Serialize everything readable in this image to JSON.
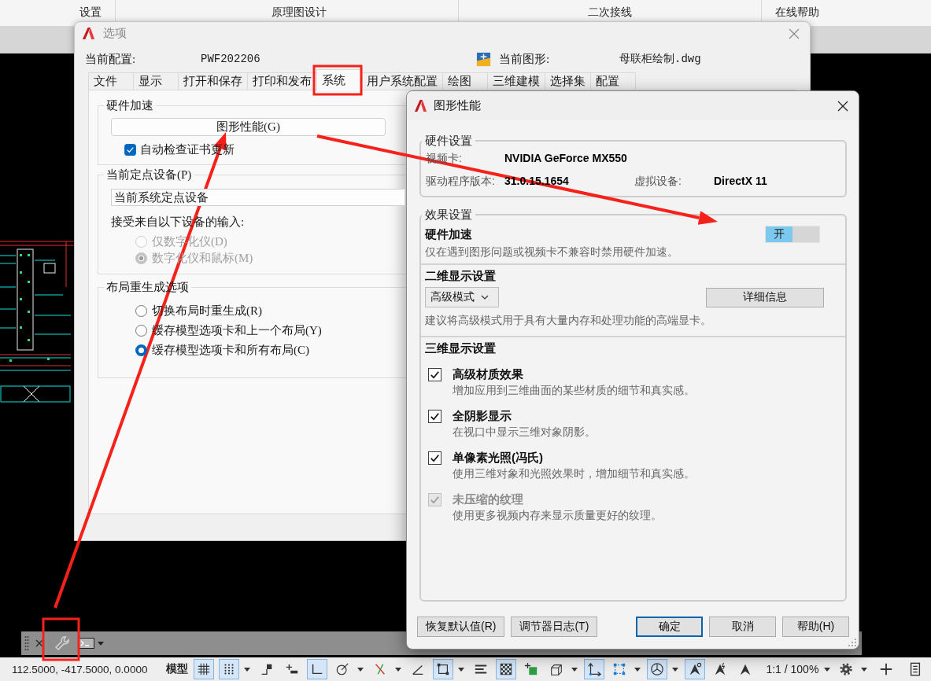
{
  "ribbon": {
    "panel_titles": [
      "设置",
      "原理图设计",
      "二次接线",
      "在线帮助"
    ]
  },
  "options_dialog": {
    "title": "选项",
    "profile_label": "当前配置:",
    "profile": "PWF202206",
    "drawing_label": "当前图形:",
    "drawing": "母联柜绘制.dwg",
    "tabs": [
      {
        "label": "文件",
        "selected": false
      },
      {
        "label": "显示",
        "selected": false
      },
      {
        "label": "打开和保存",
        "selected": false
      },
      {
        "label": "打印和发布",
        "selected": false
      },
      {
        "label": "系统",
        "selected": true
      },
      {
        "label": "用户系统配置",
        "selected": false
      },
      {
        "label": "绘图",
        "selected": false
      },
      {
        "label": "三维建模",
        "selected": false
      },
      {
        "label": "选择集",
        "selected": false
      },
      {
        "label": "配置",
        "selected": false
      }
    ],
    "hardware_group": {
      "title": "硬件加速",
      "button": "图形性能(G)",
      "checkbox": {
        "label": "自动检查证书更新",
        "checked": true
      }
    },
    "pointing_group": {
      "title": "当前定点设备(P)",
      "device": "当前系统定点设备",
      "input_label": "接受来自以下设备的输入:",
      "options": [
        {
          "label": "仅数字化仪(D)",
          "selected": false,
          "disabled": true
        },
        {
          "label": "数字化仪和鼠标(M)",
          "selected": true,
          "disabled": true
        }
      ]
    },
    "layout_group": {
      "title": "布局重生成选项",
      "options": [
        {
          "label": "切换布局时重生成(R)",
          "selected": false,
          "disabled": false
        },
        {
          "label": "缓存模型选项卡和上一个布局(Y)",
          "selected": false,
          "disabled": false
        },
        {
          "label": "缓存模型选项卡和所有布局(C)",
          "selected": true,
          "disabled": false
        }
      ]
    }
  },
  "graphics_dialog": {
    "title": "图形性能",
    "hardware": {
      "title": "硬件设置",
      "card_label": "视频卡:",
      "card": "NVIDIA GeForce MX550",
      "driver_label": "驱动程序版本:",
      "driver": "31.0.15.1654",
      "device_label": "虚拟设备:",
      "device": "DirectX 11"
    },
    "effects": {
      "title": "效果设置",
      "acceleration": {
        "title": "硬件加速",
        "toggle_label": "开",
        "on": true,
        "description": "仅在遇到图形问题或视频卡不兼容时禁用硬件加速。"
      },
      "display_2d": {
        "title": "二维显示设置",
        "mode": "高级模式",
        "details_button": "详细信息",
        "description": "建议将高级模式用于具有大量内存和处理功能的高端显卡。"
      },
      "display_3d": {
        "title": "三维显示设置",
        "options": [
          {
            "label": "高级材质效果",
            "description": "增加应用到三维曲面的某些材质的细节和真实感。",
            "checked": true,
            "disabled": false
          },
          {
            "label": "全阴影显示",
            "description": "在视口中显示三维对象阴影。",
            "checked": true,
            "disabled": false
          },
          {
            "label": "单像素光照(冯氏)",
            "description": "使用三维对象和光照效果时，增加细节和真实感。",
            "checked": true,
            "disabled": false
          },
          {
            "label": "未压缩的纹理",
            "description": "使用更多视频内存来显示质量更好的纹理。",
            "checked": true,
            "disabled": true
          }
        ]
      }
    },
    "buttons": [
      {
        "label": "恢复默认值(R)",
        "default": false
      },
      {
        "label": "调节器日志(T)",
        "default": false
      },
      {
        "label": "确定",
        "default": true
      },
      {
        "label": "取消",
        "default": false
      },
      {
        "label": "帮助(H)",
        "default": false
      }
    ]
  },
  "status_bar": {
    "coordinates": "112.5000, -417.5000, 0.0000",
    "space": "模型",
    "tools": [
      {
        "kind": "grid",
        "on": true,
        "menu": false
      },
      {
        "kind": "dot-grid",
        "on": true,
        "menu": true
      },
      {
        "kind": "steps",
        "on": false,
        "menu": false
      },
      {
        "kind": "plus-line",
        "on": false,
        "menu": false
      },
      {
        "kind": "corner",
        "on": true,
        "menu": false
      },
      {
        "kind": "circle-angle",
        "on": false,
        "menu": true
      },
      {
        "kind": "crossed-lines",
        "on": false,
        "menu": true
      },
      {
        "kind": "angle",
        "on": false,
        "menu": false
      },
      {
        "kind": "square-handles",
        "on": true,
        "menu": true
      },
      {
        "kind": "lines",
        "on": false,
        "menu": false
      },
      {
        "kind": "checker",
        "on": true,
        "menu": false
      },
      {
        "kind": "square-plus",
        "on": false,
        "menu": false
      },
      {
        "kind": "cube",
        "on": false,
        "menu": true
      },
      {
        "kind": "axes",
        "on": true,
        "menu": false
      },
      {
        "kind": "dashed-square",
        "on": false,
        "menu": true
      },
      {
        "kind": "sphere-axes",
        "on": true,
        "menu": true
      },
      {
        "kind": "peak-circle",
        "on": true,
        "menu": false
      },
      {
        "kind": "peak-spark",
        "on": false,
        "menu": false
      },
      {
        "kind": "peak",
        "on": false,
        "menu": false
      }
    ],
    "scale": "1:1 / 100%"
  }
}
